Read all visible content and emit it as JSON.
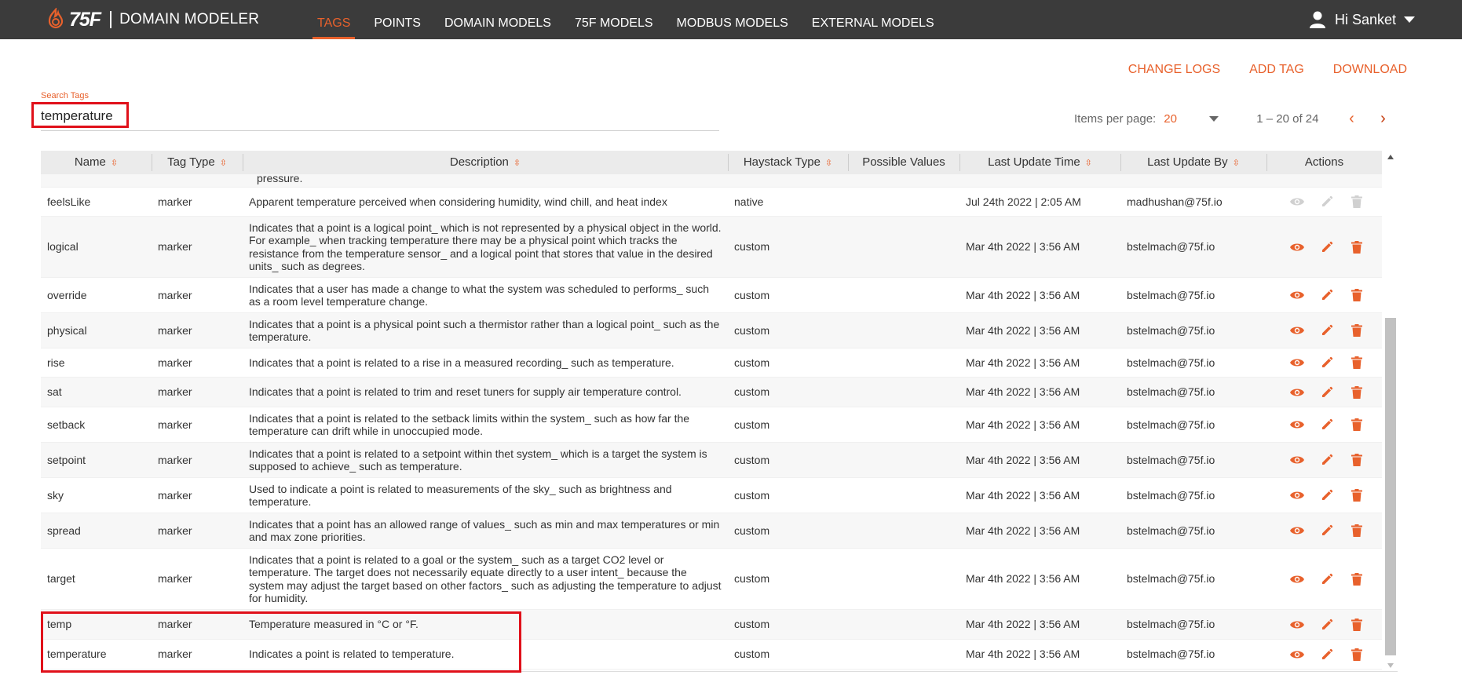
{
  "header": {
    "brand": "75F",
    "app_name": "DOMAIN MODELER",
    "nav": [
      {
        "label": "TAGS",
        "active": true
      },
      {
        "label": "POINTS"
      },
      {
        "label": "DOMAIN MODELS"
      },
      {
        "label": "75F MODELS"
      },
      {
        "label": "MODBUS MODELS"
      },
      {
        "label": "EXTERNAL MODELS"
      }
    ],
    "user_greeting": "Hi Sanket"
  },
  "toolbar": {
    "change_logs": "CHANGE LOGS",
    "add_tag": "ADD TAG",
    "download": "DOWNLOAD"
  },
  "search": {
    "label": "Search Tags",
    "value": "temperature"
  },
  "pagination": {
    "items_per_page_label": "Items per page:",
    "items_per_page": "20",
    "range": "1 – 20 of 24"
  },
  "table": {
    "columns": [
      "Name",
      "Tag Type",
      "Description",
      "Haystack Type",
      "Possible Values",
      "Last Update Time",
      "Last Update By",
      "Actions"
    ],
    "partial_row_text": "pressure.",
    "rows": [
      {
        "name": "feelsLike",
        "type": "marker",
        "description": "Apparent temperature perceived when considering humidity, wind chill, and heat index",
        "haystack": "native",
        "possible": "",
        "time": "Jul 24th 2022 | 2:05 AM",
        "by": "madhushan@75f.io",
        "disabled": true
      },
      {
        "name": "logical",
        "type": "marker",
        "description": "Indicates that a point is a logical point_ which is not represented by a physical object in the world. For example_ when tracking temperature there may be a physical point which tracks the resistance from the temperature sensor_ and a logical point that stores that value in the desired units_ such as degrees.",
        "haystack": "custom",
        "possible": "",
        "time": "Mar 4th 2022 | 3:56 AM",
        "by": "bstelmach@75f.io"
      },
      {
        "name": "override",
        "type": "marker",
        "description": "Indicates that a user has made a change to what the system was scheduled to performs_ such as a room level temperature change.",
        "haystack": "custom",
        "possible": "",
        "time": "Mar 4th 2022 | 3:56 AM",
        "by": "bstelmach@75f.io"
      },
      {
        "name": "physical",
        "type": "marker",
        "description": "Indicates that a point is a physical point such a thermistor rather than a logical point_ such as the temperature.",
        "haystack": "custom",
        "possible": "",
        "time": "Mar 4th 2022 | 3:56 AM",
        "by": "bstelmach@75f.io"
      },
      {
        "name": "rise",
        "type": "marker",
        "description": "Indicates that a point is related to a rise in a measured recording_ such as temperature.",
        "haystack": "custom",
        "possible": "",
        "time": "Mar 4th 2022 | 3:56 AM",
        "by": "bstelmach@75f.io"
      },
      {
        "name": "sat",
        "type": "marker",
        "description": "Indicates that a point is related to trim and reset tuners for supply air temperature control.",
        "haystack": "custom",
        "possible": "",
        "time": "Mar 4th 2022 | 3:56 AM",
        "by": "bstelmach@75f.io"
      },
      {
        "name": "setback",
        "type": "marker",
        "description": "Indicates that a point is related to the setback limits within the system_ such as how far the temperature can drift while in unoccupied mode.",
        "haystack": "custom",
        "possible": "",
        "time": "Mar 4th 2022 | 3:56 AM",
        "by": "bstelmach@75f.io"
      },
      {
        "name": "setpoint",
        "type": "marker",
        "description": "Indicates that a point is related to a setpoint within thet system_ which is a target the system is supposed to achieve_ such as temperature.",
        "haystack": "custom",
        "possible": "",
        "time": "Mar 4th 2022 | 3:56 AM",
        "by": "bstelmach@75f.io"
      },
      {
        "name": "sky",
        "type": "marker",
        "description": "Used to indicate a point is related to measurements of the sky_ such as brightness and temperature.",
        "haystack": "custom",
        "possible": "",
        "time": "Mar 4th 2022 | 3:56 AM",
        "by": "bstelmach@75f.io"
      },
      {
        "name": "spread",
        "type": "marker",
        "description": "Indicates that a point has an allowed range of values_ such as min and max temperatures or min and max zone priorities.",
        "haystack": "custom",
        "possible": "",
        "time": "Mar 4th 2022 | 3:56 AM",
        "by": "bstelmach@75f.io"
      },
      {
        "name": "target",
        "type": "marker",
        "description": "Indicates that a point is related to a goal or the system_ such as a target CO2 level or temperature. The target does not necessarily equate directly to a user intent_ because the system may adjust the target based on other factors_ such as adjusting the temperature to adjust for humidity.",
        "haystack": "custom",
        "possible": "",
        "time": "Mar 4th 2022 | 3:56 AM",
        "by": "bstelmach@75f.io"
      },
      {
        "name": "temp",
        "type": "marker",
        "description": "Temperature measured in °C or °F.",
        "haystack": "custom",
        "possible": "",
        "time": "Mar 4th 2022 | 3:56 AM",
        "by": "bstelmach@75f.io"
      },
      {
        "name": "temperature",
        "type": "marker",
        "description": "Indicates a point is related to temperature.",
        "haystack": "custom",
        "possible": "",
        "time": "Mar 4th 2022 | 3:56 AM",
        "by": "bstelmach@75f.io"
      }
    ]
  },
  "colors": {
    "accent": "#e8612c",
    "header_bg": "#3b3b3b",
    "highlight": "#e0101a",
    "action_disabled": "#d0d0d0"
  }
}
